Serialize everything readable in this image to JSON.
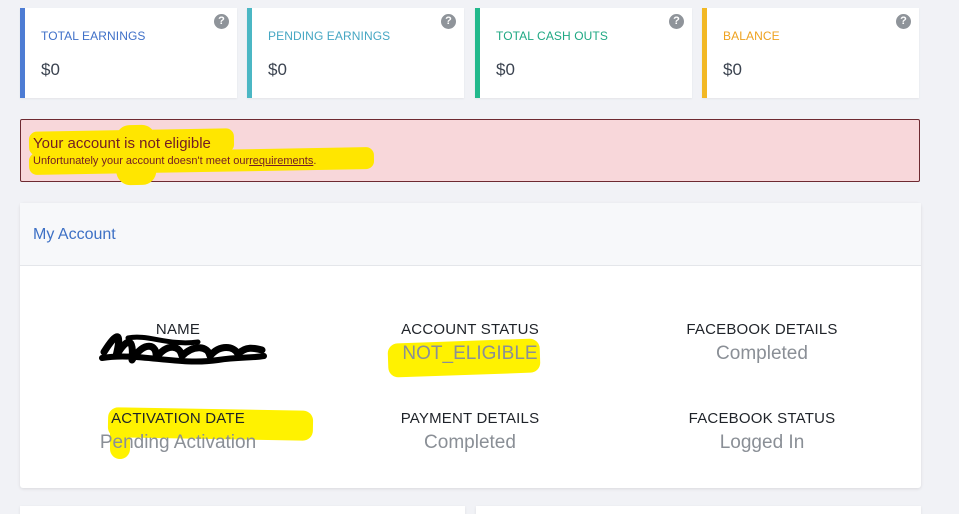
{
  "stats": [
    {
      "label": "TOTAL EARNINGS",
      "value": "$0",
      "color": "#4d7cd4",
      "help_icon": "?"
    },
    {
      "label": "PENDING EARNINGS",
      "value": "$0",
      "color": "#4bb7c4",
      "help_icon": "?"
    },
    {
      "label": "TOTAL CASH OUTS",
      "value": "$0",
      "color": "#22b98c",
      "help_icon": "?"
    },
    {
      "label": "BALANCE",
      "value": "$0",
      "color": "#f2b824",
      "help_icon": "?"
    }
  ],
  "alert": {
    "title": "Your account is not eligible",
    "text": "Unfortunately your account doesn't meet our",
    "link": "requirements",
    "end": "."
  },
  "account": {
    "title": "My Account",
    "fields": {
      "name": {
        "label": "NAME",
        "value": ""
      },
      "account_status": {
        "label": "ACCOUNT STATUS",
        "value": "NOT_ELIGIBLE"
      },
      "facebook_details": {
        "label": "FACEBOOK DETAILS",
        "value": "Completed"
      },
      "activation_date": {
        "label": "ACTIVATION DATE",
        "value": "Pending Activation"
      },
      "payment_details": {
        "label": "PAYMENT DETAILS",
        "value": "Completed"
      },
      "facebook_status": {
        "label": "FACEBOOK STATUS",
        "value": "Logged In"
      }
    }
  }
}
